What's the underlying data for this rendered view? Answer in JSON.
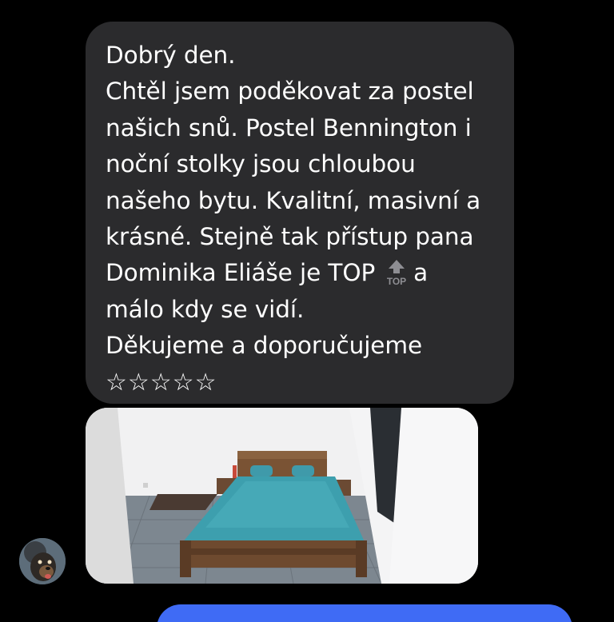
{
  "message": {
    "lines": [
      "Dobrý den.",
      "Chtěl jsem poděkovat za postel",
      "našich snů. Postel Bennington i",
      "noční stolky jsou chloubou",
      "našeho bytu. Kvalitní, masivní a",
      "krásné. Stejně tak přístup pana",
      "Dominika Eliáše je TOP",
      "a",
      "málo kdy se vidí.",
      "Děkujeme a doporučujeme",
      "☆☆☆☆☆"
    ],
    "emoji_icon": "top-arrow-emoji",
    "emoji_text": "TOP"
  },
  "attachment": {
    "type": "photo",
    "subject": "bed-photo"
  },
  "sender": {
    "avatar_icon": "dog-avatar"
  },
  "colors": {
    "background": "#000000",
    "incoming_bubble": "#2b2b2d",
    "outgoing_bubble": "#3f6bf5",
    "text": "#ffffff"
  }
}
